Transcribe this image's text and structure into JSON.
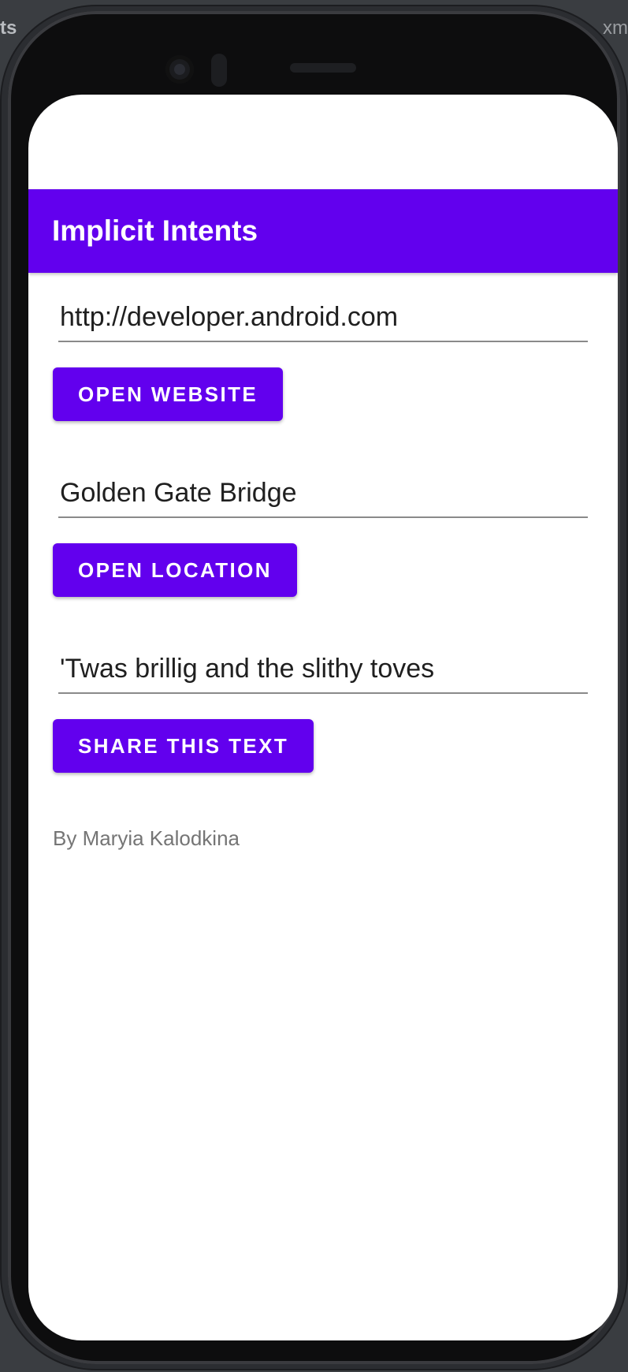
{
  "ide": {
    "left_fragment": "ts",
    "right_fragment": "xm"
  },
  "app": {
    "title": "Implicit Intents",
    "accent_color": "#6200ee"
  },
  "website": {
    "value": "http://developer.android.com",
    "button_label": "OPEN WEBSITE"
  },
  "location": {
    "value": "Golden Gate Bridge",
    "button_label": "OPEN LOCATION"
  },
  "share": {
    "value": "'Twas brillig and the slithy toves",
    "button_label": "SHARE THIS TEXT"
  },
  "footer": {
    "author": "By Maryia Kalodkina"
  }
}
